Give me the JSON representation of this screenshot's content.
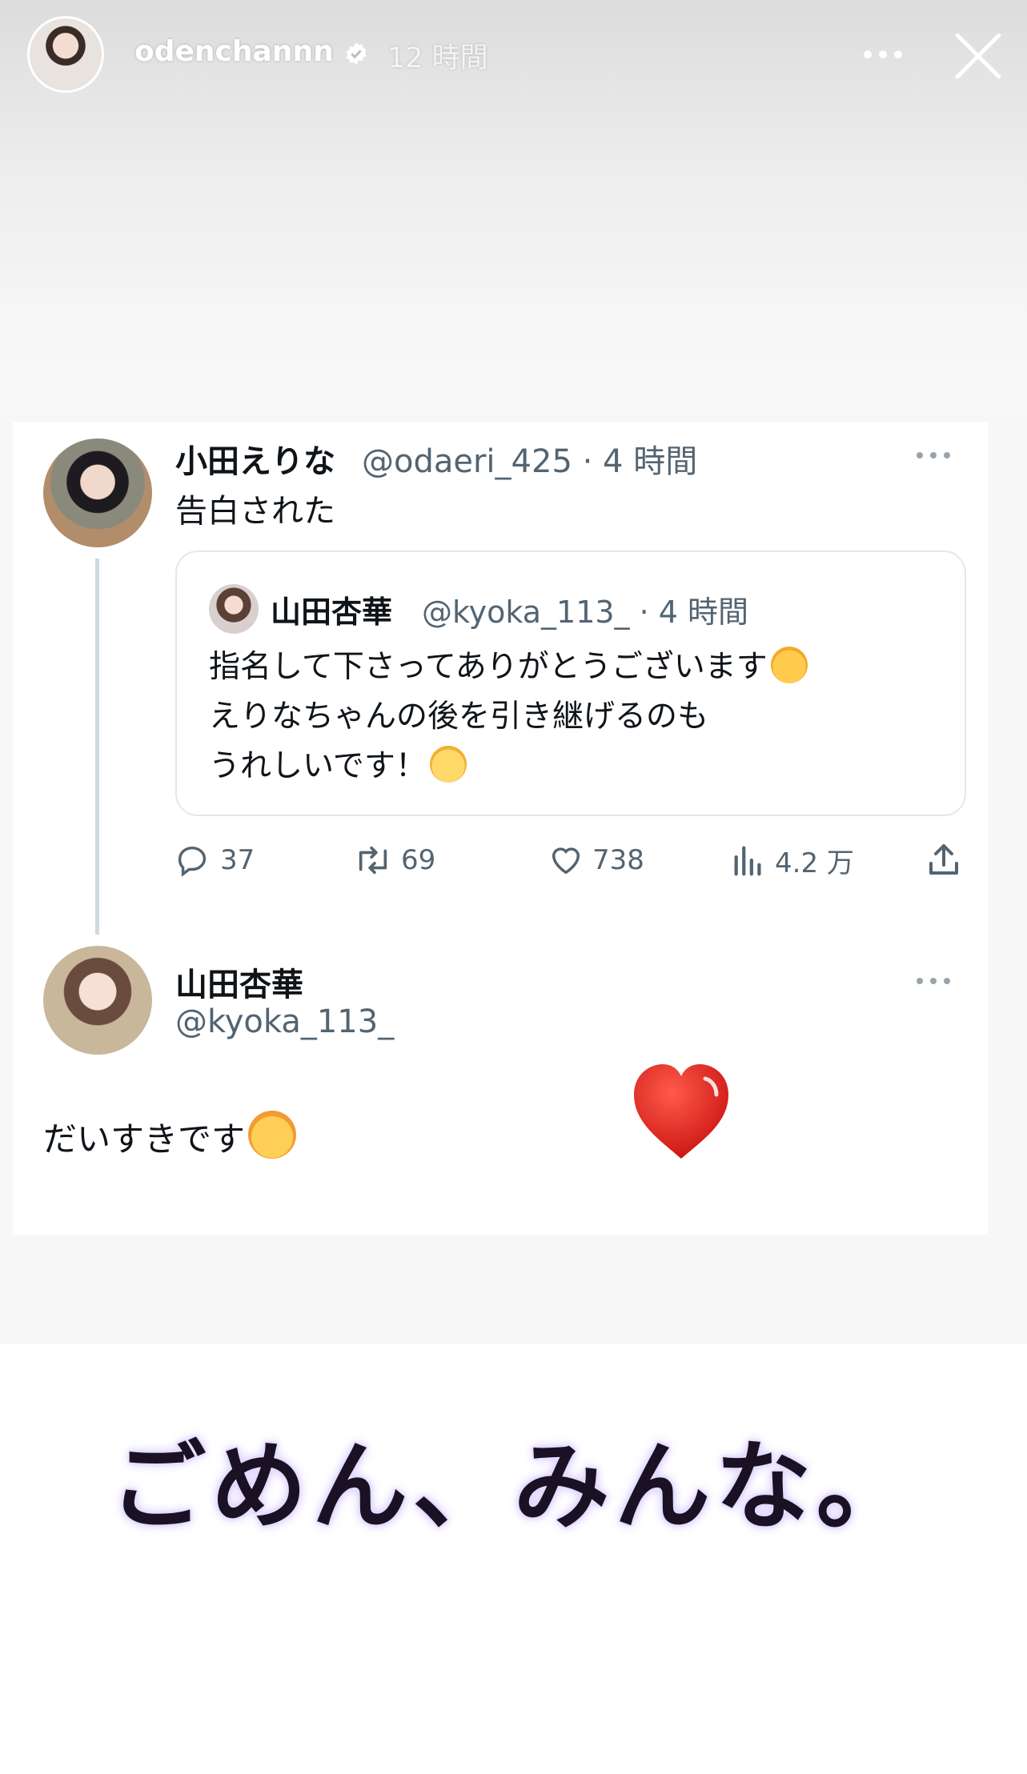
{
  "story": {
    "username": "odenchannn",
    "time": "12 時間"
  },
  "tweet": {
    "author_name": "小田えりな",
    "author_handle": "@odaeri_425 · 4 時間",
    "text": "告白された",
    "quote": {
      "author_name": "山田杏華",
      "author_handle": "@kyoka_113_ · 4 時間",
      "line1": "指名して下さってありがとうございます",
      "line2": "えりなちゃんの後を引き継げるのも",
      "line3": "うれしいです！"
    },
    "actions": {
      "replies": "37",
      "retweets": "69",
      "likes": "738",
      "views": "4.2 万"
    }
  },
  "reply": {
    "author_name": "山田杏華",
    "author_handle": "@kyoka_113_",
    "text": "だいすきです"
  },
  "caption": "ごめん、みんな。",
  "colors": {
    "heart": "#e0201c",
    "secondary_text": "#536471",
    "caption_glow": "#c8b7ff"
  }
}
